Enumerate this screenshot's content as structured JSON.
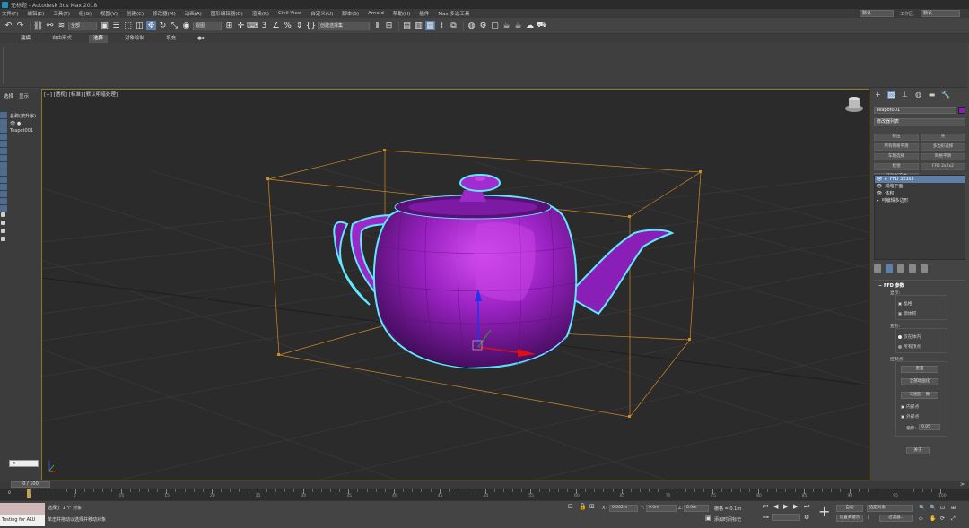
{
  "window": {
    "title": "无标题 - Autodesk 3ds Max 2018"
  },
  "menu": {
    "items": [
      "文件(F)",
      "编辑(E)",
      "工具(T)",
      "组(G)",
      "视图(V)",
      "创建(C)",
      "修改器(M)",
      "动画(A)",
      "图形编辑器(D)",
      "渲染(R)",
      "Civil View",
      "自定义(U)",
      "脚本(S)",
      "Arnold",
      "帮助(H)",
      "插件",
      "Max 多选工具"
    ],
    "workspace_value": "默认",
    "workspace_label": "工作区:",
    "workspace2_value": "默认"
  },
  "toolbar": {
    "filter_dropdown": "全部",
    "coord_dropdown": "视图",
    "selection_set": "创建选择集"
  },
  "ribbon": {
    "tabs": [
      "建模",
      "自由形式",
      "选择",
      "对象绘制",
      "填充"
    ],
    "active_tab": "选择"
  },
  "scene_explorer": {
    "tabs": [
      "选择",
      "显示"
    ],
    "header": "名称(按升序)",
    "items": [
      "Teapot001"
    ]
  },
  "viewport": {
    "label": "[+] [透视] [标准] [默认明暗处理]",
    "teapot_color": "#8a1fb8",
    "lattice_color": "#d08a2a",
    "outline_color": "#5fe8ff"
  },
  "command_panel": {
    "object_name": "Teapot001",
    "object_color": "#8a1fb8",
    "modifier_list": "修改器列表",
    "buttons": [
      "挤压",
      "壳",
      "所有网格平滑",
      "多边形选择",
      "车削选择",
      "网格平滑",
      "松弛",
      "FFD 2x2x2",
      "FFD 长方体"
    ],
    "stack": [
      {
        "label": "FFD 3x3x3",
        "selected": true
      },
      {
        "label": "减缩平面",
        "selected": false
      },
      {
        "label": "体积",
        "selected": false
      },
      {
        "label": "可编辑多边形",
        "selected": false
      }
    ],
    "rollout": {
      "title": "FFD 参数",
      "display_label": "显示:",
      "display_options": [
        {
          "label": "晶格",
          "checked": true
        },
        {
          "label": "源体积",
          "checked": false
        }
      ],
      "deform_label": "变形:",
      "deform_options": [
        {
          "label": "仅在体内",
          "checked": true
        },
        {
          "label": "所有顶点",
          "checked": false
        }
      ],
      "control_points_label": "控制点:",
      "buttons": [
        "重置",
        "全部动画化",
        "与图形一致"
      ],
      "checks": [
        {
          "label": "内部点",
          "checked": true
        },
        {
          "label": "外部点",
          "checked": true
        }
      ],
      "offset_label": "偏移:",
      "offset_value": "0.05",
      "about_button": "关于"
    }
  },
  "timeline": {
    "slider_text": "0 / 100",
    "current_frame": "0",
    "ticks": [
      "0",
      "5",
      "10",
      "15",
      "20",
      "25",
      "30",
      "35",
      "40",
      "45",
      "50",
      "55",
      "60",
      "65",
      "70",
      "75",
      "80",
      "85",
      "90",
      "95",
      "100"
    ]
  },
  "status": {
    "script_output": "Testing for ALU",
    "selected": "选择了 1 个 对象",
    "hint": "单击并拖动以选择并移动对象",
    "x_value": "0.002m",
    "y_value": "0.0m",
    "z_value": "0.0m",
    "grid": "栅格 = 0.1m",
    "add_time_tag": "添加时间标记",
    "auto_key": "自动",
    "set_key": "设置关键点",
    "key_filter": "选定对象",
    "filters": "过滤器..."
  }
}
